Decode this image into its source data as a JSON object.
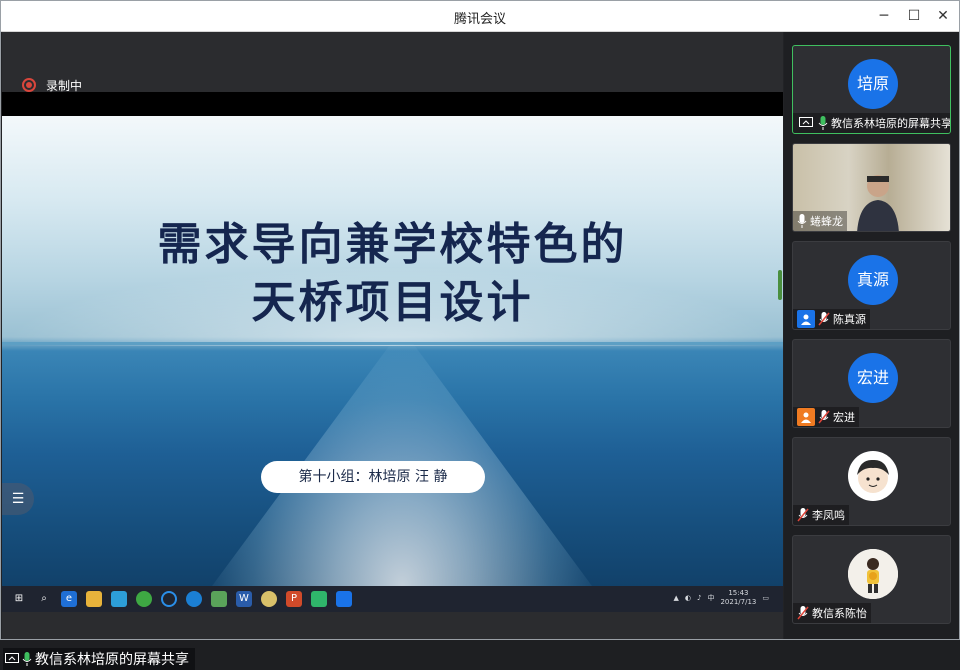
{
  "window": {
    "title": "腾讯会议"
  },
  "recording": {
    "label": "录制中"
  },
  "slide": {
    "title_line1": "需求导向兼学校特色的",
    "title_line2": "天桥项目设计",
    "subtitle": "第十小组：林培原 汪 静"
  },
  "taskbar": {
    "time": "15:43",
    "date": "2021/7/13"
  },
  "share_label": "教信系林培原的屏幕共享",
  "participants": [
    {
      "avatar": "培原",
      "name": "教信系林培原的屏幕共享",
      "mic": "on",
      "badge": "screen-share-icon",
      "active": true
    },
    {
      "avatar": "",
      "name": "蜷蜂龙",
      "mic": "on",
      "badge": "",
      "video": true
    },
    {
      "avatar": "真源",
      "name": "陈真源",
      "mic": "muted",
      "badge": "user-icon",
      "badge_color": "#1a73e8"
    },
    {
      "avatar": "宏进",
      "name": "宏进",
      "mic": "muted",
      "badge": "user-icon",
      "badge_color": "#f07b22"
    },
    {
      "avatar": "",
      "name": "李凤鸣",
      "mic": "muted",
      "badge": ""
    },
    {
      "avatar": "",
      "name": "教信系陈怡",
      "mic": "muted",
      "badge": ""
    }
  ],
  "colors": {
    "accent": "#1a73e8",
    "active_border": "#3fbf5f",
    "record": "#d9463c",
    "title_text": "#15264f"
  }
}
